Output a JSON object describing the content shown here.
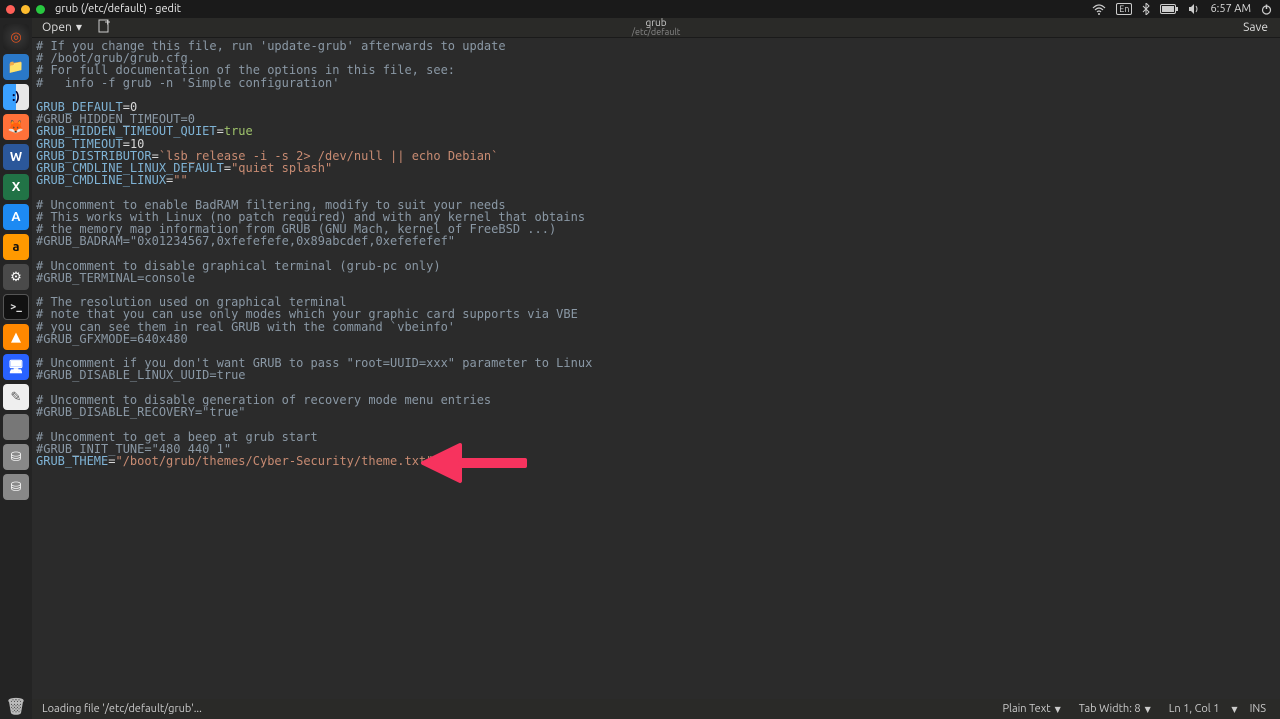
{
  "menubar": {
    "title": "grub (/etc/default) - gedit"
  },
  "topright": {
    "lang": "En",
    "time": "6:57 AM"
  },
  "launcher": {
    "items": [
      {
        "name": "ubuntu",
        "g": "◎"
      },
      {
        "name": "files",
        "g": "📁"
      },
      {
        "name": "finder",
        "g": ":)"
      },
      {
        "name": "firefox",
        "g": "🦊"
      },
      {
        "name": "word",
        "g": "W"
      },
      {
        "name": "excel",
        "g": "X"
      },
      {
        "name": "appstore",
        "g": "A"
      },
      {
        "name": "amazon",
        "g": "a"
      },
      {
        "name": "settings",
        "g": "⚙"
      },
      {
        "name": "terminal",
        "g": ">_"
      },
      {
        "name": "vlc",
        "g": "▲"
      },
      {
        "name": "screen",
        "g": "🖥"
      },
      {
        "name": "gedit",
        "g": "✎"
      },
      {
        "name": "grey1",
        "g": " "
      },
      {
        "name": "disk1",
        "g": "⛁"
      },
      {
        "name": "disk2",
        "g": "⛁"
      }
    ],
    "trash": "🗑"
  },
  "toolbar": {
    "open_label": "Open",
    "doc_name": "grub",
    "doc_path": "/etc/default",
    "save_label": "Save"
  },
  "status": {
    "left": "Loading file '/etc/default/grub'...",
    "lang": "Plain Text",
    "tab": "Tab Width: 8",
    "pos": "Ln 1, Col 1",
    "ins": "INS"
  },
  "file": {
    "l1": "# If you change this file, run 'update-grub' afterwards to update",
    "l2": "# /boot/grub/grub.cfg.",
    "l3": "# For full documentation of the options in this file, see:",
    "l4": "#   info -f grub -n 'Simple configuration'",
    "l5": "",
    "l6a": "GRUB_DEFAULT",
    "l6b": "=",
    "l6c": "0",
    "l7": "#GRUB_HIDDEN_TIMEOUT=0",
    "l8a": "GRUB_HIDDEN_TIMEOUT_QUIET",
    "l8b": "=",
    "l8c": "true",
    "l9a": "GRUB_TIMEOUT",
    "l9b": "=",
    "l9c": "10",
    "l10a": "GRUB_DISTRIBUTOR",
    "l10b": "=",
    "l10c": "`lsb_release -i -s 2> /dev/null || echo Debian`",
    "l11a": "GRUB_CMDLINE_LINUX_DEFAULT",
    "l11b": "=",
    "l11c": "\"quiet splash\"",
    "l12a": "GRUB_CMDLINE_LINUX",
    "l12b": "=",
    "l12c": "\"\"",
    "l13": "",
    "l14": "# Uncomment to enable BadRAM filtering, modify to suit your needs",
    "l15": "# This works with Linux (no patch required) and with any kernel that obtains",
    "l16": "# the memory map information from GRUB (GNU Mach, kernel of FreeBSD ...)",
    "l17": "#GRUB_BADRAM=\"0x01234567,0xfefefefe,0x89abcdef,0xefefefef\"",
    "l18": "",
    "l19": "# Uncomment to disable graphical terminal (grub-pc only)",
    "l20": "#GRUB_TERMINAL=console",
    "l21": "",
    "l22": "# The resolution used on graphical terminal",
    "l23": "# note that you can use only modes which your graphic card supports via VBE",
    "l24": "# you can see them in real GRUB with the command `vbeinfo'",
    "l25": "#GRUB_GFXMODE=640x480",
    "l26": "",
    "l27": "# Uncomment if you don't want GRUB to pass \"root=UUID=xxx\" parameter to Linux",
    "l28": "#GRUB_DISABLE_LINUX_UUID=true",
    "l29": "",
    "l30": "# Uncomment to disable generation of recovery mode menu entries",
    "l31": "#GRUB_DISABLE_RECOVERY=\"true\"",
    "l32": "",
    "l33": "# Uncomment to get a beep at grub start",
    "l34": "#GRUB_INIT_TUNE=\"480 440 1\"",
    "l35a": "GRUB_THEME",
    "l35b": "=",
    "l35c": "\"/boot/grub/themes/Cyber-Security/theme.txt\""
  }
}
